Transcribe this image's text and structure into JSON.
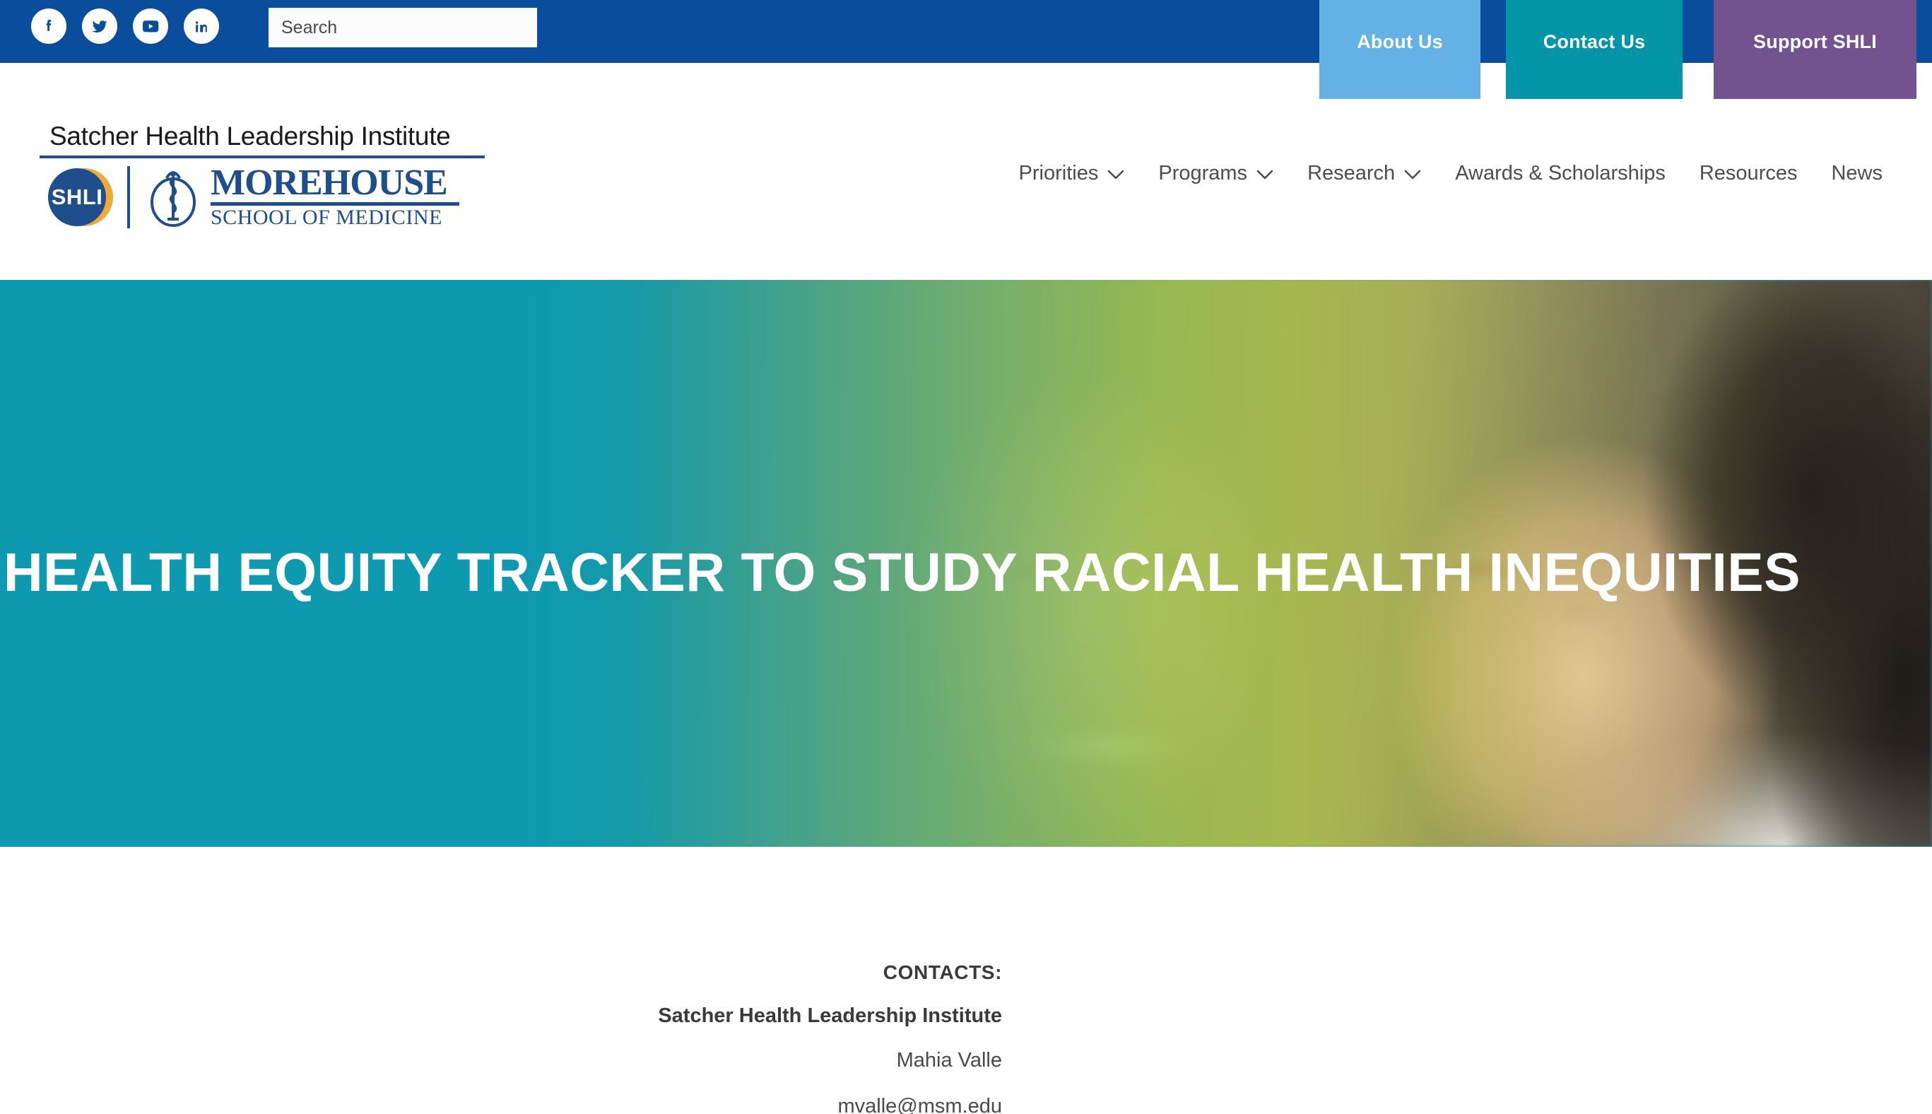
{
  "topbar": {
    "social": [
      {
        "name": "facebook-icon",
        "label": "Facebook"
      },
      {
        "name": "twitter-icon",
        "label": "Twitter"
      },
      {
        "name": "youtube-icon",
        "label": "YouTube"
      },
      {
        "name": "linkedin-icon",
        "label": "LinkedIn"
      }
    ],
    "search": {
      "placeholder": "Search",
      "value": ""
    },
    "buttons": [
      {
        "label": "About Us",
        "color": "#63B1E5"
      },
      {
        "label": "Contact Us",
        "color": "#0295A8"
      },
      {
        "label": "Support SHLI",
        "color": "#72528F"
      }
    ],
    "background": "#0A4D9C"
  },
  "logo": {
    "institute_name": "Satcher Health Leadership Institute",
    "badge_text": "SHLI",
    "school_top": "MOREHOUSE",
    "school_bottom": "SCHOOL OF MEDICINE",
    "brand_blue": "#1F4E8C",
    "brand_gold": "#F2A93B"
  },
  "nav": {
    "items": [
      {
        "label": "Priorities",
        "has_dropdown": true
      },
      {
        "label": "Programs",
        "has_dropdown": true
      },
      {
        "label": "Research",
        "has_dropdown": true
      },
      {
        "label": "Awards & Scholarships",
        "has_dropdown": false
      },
      {
        "label": "Resources",
        "has_dropdown": false
      },
      {
        "label": "News",
        "has_dropdown": false
      }
    ]
  },
  "hero": {
    "title": "HEALTH EQUITY TRACKER TO STUDY RACIAL HEALTH INEQUITIES",
    "gradient_start": "#0D9AB0",
    "gradient_end": "#C6D63E"
  },
  "contacts": {
    "heading": "CONTACTS:",
    "organization": "Satcher Health Leadership Institute",
    "person": "Mahia Valle",
    "email": "mvalle@msm.edu"
  }
}
